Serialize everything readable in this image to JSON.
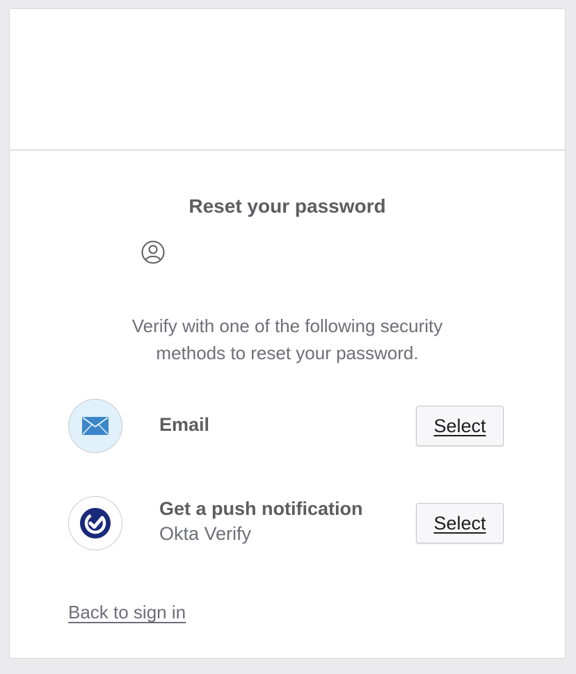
{
  "page": {
    "title": "Reset your password",
    "subtitle_line1": "Verify with one of the following security",
    "subtitle_line2": "methods to reset your password."
  },
  "user_icon": "user-circle-icon",
  "methods": [
    {
      "label": "Email",
      "description": "",
      "icon": "envelope-icon",
      "button_label": "Select"
    },
    {
      "label": "Get a push notification",
      "description": "Okta Verify",
      "icon": "okta-verify-check-icon",
      "button_label": "Select"
    }
  ],
  "footer": {
    "back_link": "Back to sign in"
  },
  "colors": {
    "background": "#ebebed",
    "card": "#ffffff",
    "text_primary": "#5d5d61",
    "text_secondary": "#6e6e78",
    "email_icon_bg": "#e1f1fc",
    "email_icon_fg": "#3a86c8",
    "okta_blue": "#1a2a7a"
  }
}
